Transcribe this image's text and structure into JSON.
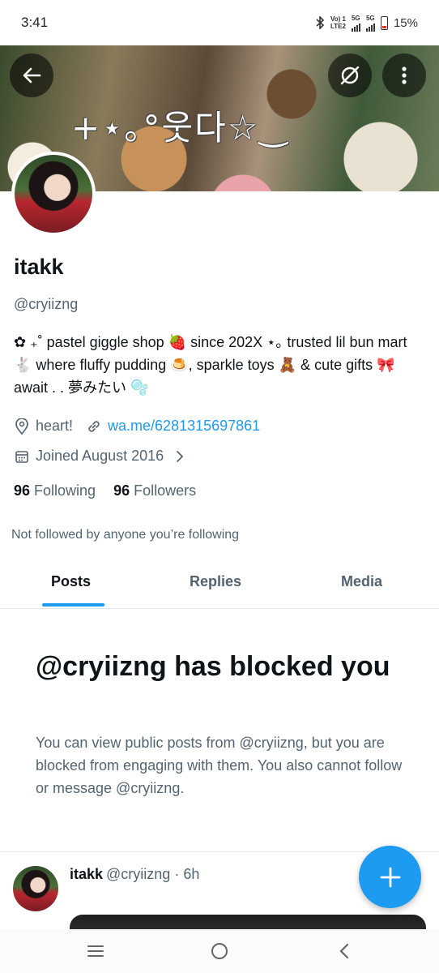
{
  "status_bar": {
    "time": "3:41",
    "volte_top": "Vo) 1",
    "volte_bottom": "LTE2",
    "signal1_label": "5G",
    "signal2_label": "5G",
    "battery": "15%"
  },
  "header": {
    "banner_text": "+⋆｡°웃다☆‿",
    "back_icon": "arrow-left-icon",
    "grok_icon": "grok-icon",
    "more_icon": "more-vertical-icon"
  },
  "profile": {
    "name": "itakk",
    "handle": "@cryiizng",
    "bio": "✿ ₊˚ pastel giggle shop 🍓 since 202X ⋆｡ trusted lil bun mart 🐇 where fluffy pudding 🍮, sparkle toys 🧸 & cute gifts 🎀 await . . 夢みたい 🫧",
    "location": "heart!",
    "website": "wa.me/6281315697861",
    "joined": "Joined August 2016",
    "following_count": "96",
    "following_label": "Following",
    "followers_count": "96",
    "followers_label": "Followers",
    "not_followed": "Not followed by anyone you’re following"
  },
  "tabs": [
    {
      "label": "Posts",
      "active": true
    },
    {
      "label": "Replies",
      "active": false
    },
    {
      "label": "Media",
      "active": false
    }
  ],
  "blocked": {
    "title": "@cryiizng has blocked you",
    "description": "You can view public posts from @cryiizng, but you are blocked from engaging with them. You also cannot follow or message @cryiizng."
  },
  "post": {
    "name": "itakk",
    "handle_time": "@cryiizng · 6h"
  },
  "colors": {
    "accent": "#1d9bf0",
    "secondary_text": "#536471"
  }
}
